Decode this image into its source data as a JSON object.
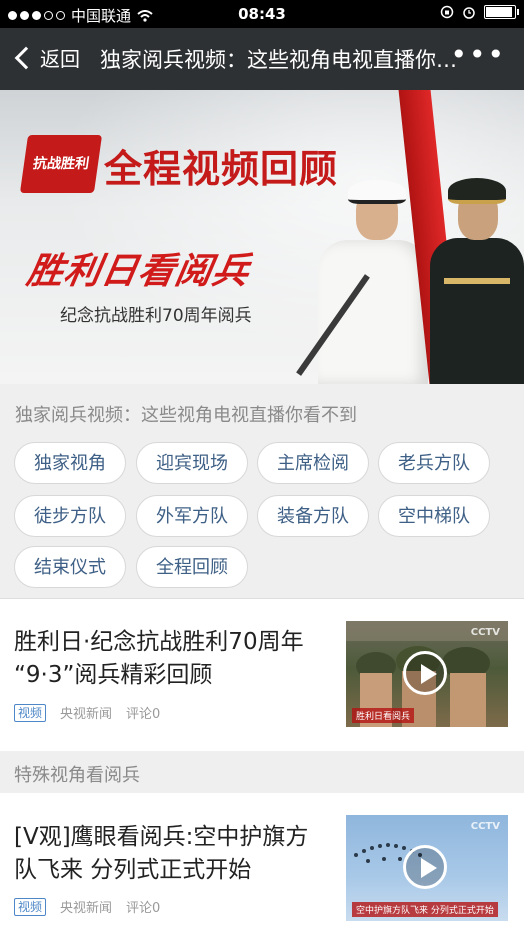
{
  "status_bar": {
    "carrier": "中国联通",
    "time": "08:43"
  },
  "nav": {
    "back_label": "返回",
    "title": "独家阅兵视频：这些视角电视直播你看不到",
    "more_label": "•••"
  },
  "banner": {
    "logo_text": "抗战胜利",
    "title": "全程视频回顾",
    "slogan": "胜利日看阅兵",
    "subtitle": "纪念抗战胜利70周年阅兵"
  },
  "tag_panel": {
    "heading": "独家阅兵视频：这些视角电视直播你看不到",
    "tags": [
      "独家视角",
      "迎宾现场",
      "主席检阅",
      "老兵方队",
      "徒步方队",
      "外军方队",
      "装备方队",
      "空中梯队",
      "结束仪式",
      "全程回顾"
    ]
  },
  "articles": [
    {
      "title": "胜利日·纪念抗战胜利70周年 “9·3”阅兵精彩回顾",
      "badge": "视频",
      "source": "央视新闻",
      "comments": "评论0"
    },
    {
      "title": "[V观]鹰眼看阅兵:空中护旗方队飞来 分列式正式开始",
      "badge": "视频",
      "source": "央视新闻",
      "comments": "评论0"
    }
  ],
  "section": {
    "label": "特殊视角看阅兵"
  },
  "thumbnails": {
    "first_caption": "胜利日看阅兵",
    "second_caption": "空中护旗方队飞来 分列式正式开始"
  }
}
